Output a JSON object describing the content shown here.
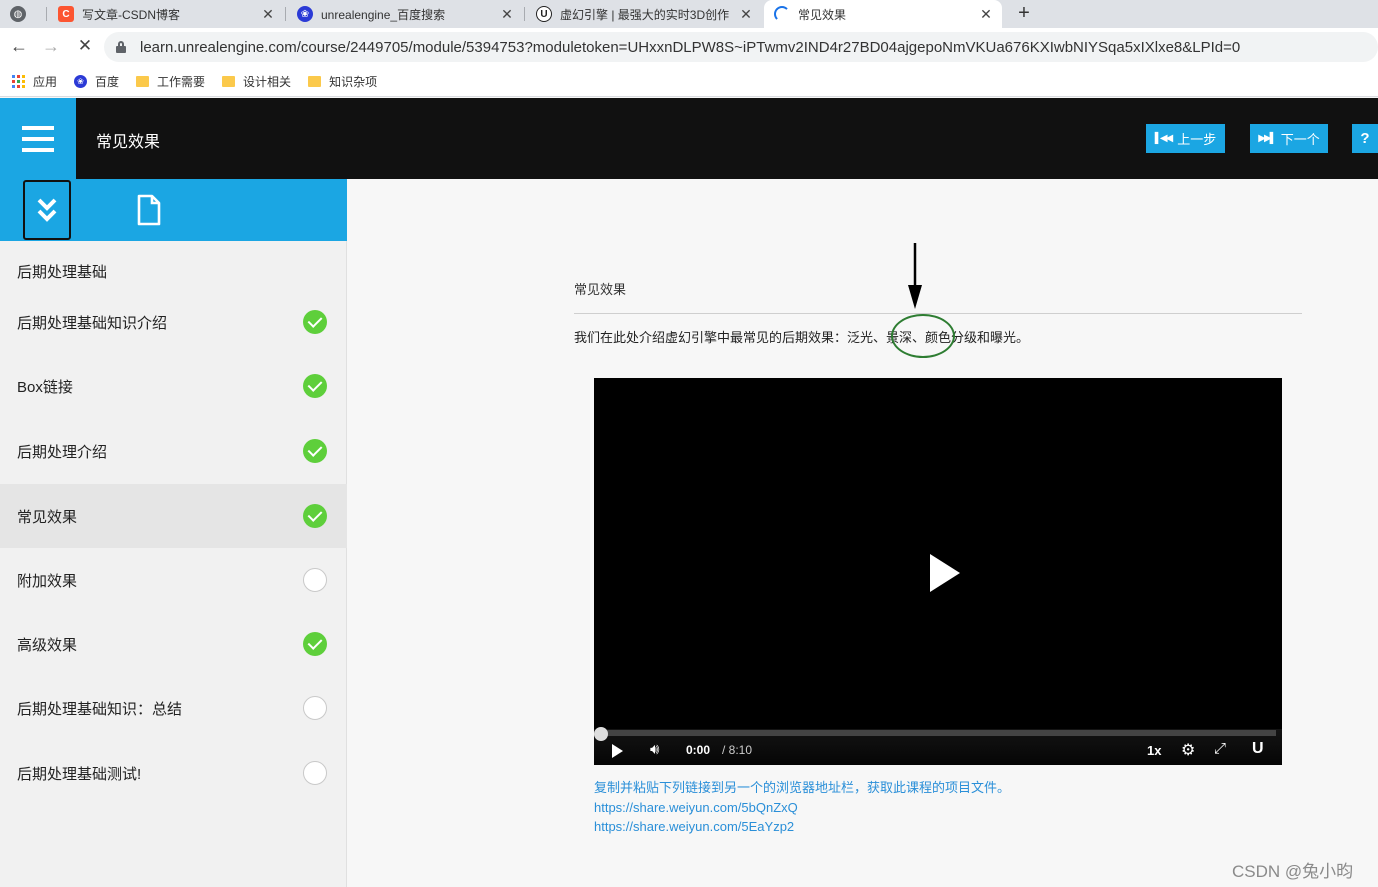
{
  "browser": {
    "tabs": [
      {
        "label": "",
        "icon": "globe-icon"
      },
      {
        "label": "写文章-CSDN博客",
        "icon": "csdn-logo-icon",
        "favicon_letter": "C"
      },
      {
        "label": "unrealengine_百度搜索",
        "icon": "baidu-paw-icon"
      },
      {
        "label": "虚幻引擎 | 最强大的实时3D创作",
        "icon": "unreal-logo-icon",
        "favicon_letter": "U"
      },
      {
        "label": "常见效果",
        "icon": "loading-spinner-icon",
        "active": true
      }
    ],
    "url": "learn.unrealengine.com/course/2449705/module/5394753?moduletoken=UHxxnDLPW8S~iPTwmv2IND4r27BD04ajgepoNmVKUa676KXIwbNIYSqa5xIXlxe8&LPId=0",
    "bookmarks": [
      "应用",
      "百度",
      "工作需要",
      "设计相关",
      "知识杂项"
    ]
  },
  "header": {
    "title": "常见效果",
    "prev_label": "上一步",
    "next_label": "下一个",
    "help_label": "?"
  },
  "sidebar": {
    "section_title": "后期处理基础",
    "items": [
      {
        "label": "后期处理基础知识介绍",
        "status": "complete"
      },
      {
        "label": "Box链接",
        "status": "complete"
      },
      {
        "label": "后期处理介绍",
        "status": "complete"
      },
      {
        "label": "常见效果",
        "status": "complete",
        "active": true
      },
      {
        "label": "附加效果",
        "status": "incomplete"
      },
      {
        "label": "高级效果",
        "status": "complete"
      },
      {
        "label": "后期处理基础知识：总结",
        "status": "incomplete"
      },
      {
        "label": "后期处理基础测试!",
        "status": "incomplete"
      }
    ]
  },
  "content": {
    "title": "常见效果",
    "description": "我们在此处介绍虚幻引擎中最常见的后期效果：泛光、景深、颜色分级和曝光。",
    "video": {
      "current_time": "0:00",
      "duration": "/ 8:10",
      "speed": "1x",
      "progress": 0
    },
    "project_note": "复制并粘贴下列链接到另一个的浏览器地址栏，获取此课程的项目文件。",
    "links": [
      "https://share.weiyun.com/5bQnZxQ",
      "https://share.weiyun.com/5EaYzp2"
    ]
  },
  "watermark": "CSDN @兔小昀",
  "colors": {
    "accent": "#1ba6e3",
    "header_bg": "#111111",
    "complete": "#5ecf3b",
    "annotation": "#2e7d32",
    "link": "#2a8fd8"
  }
}
